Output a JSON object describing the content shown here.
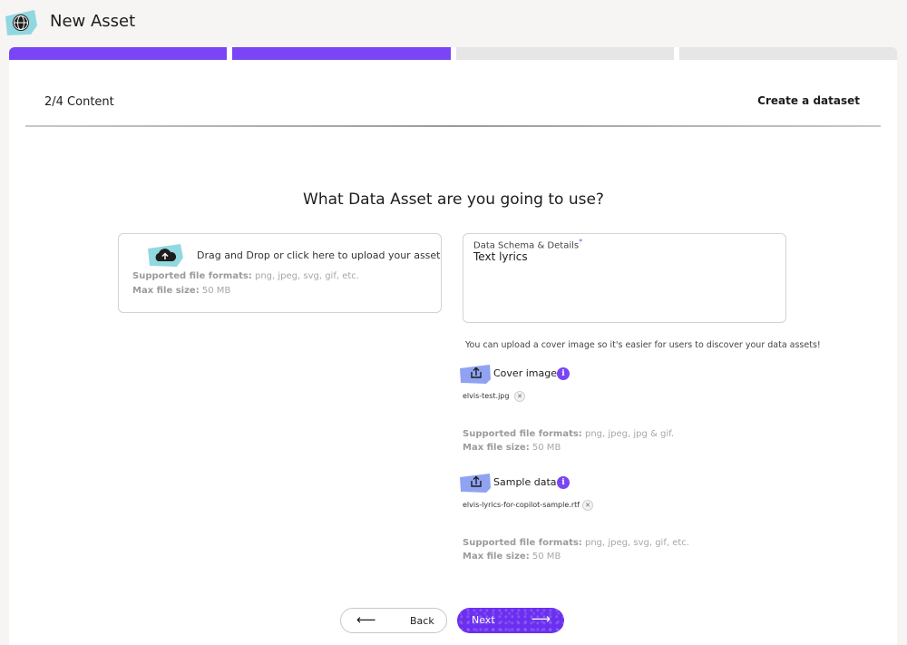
{
  "header": {
    "title": "New Asset",
    "logo_icon": "globe-logo-icon"
  },
  "progress": {
    "total_steps": 4,
    "completed_steps": 2,
    "active_color": "#7a45f5",
    "inactive_color": "#e6e6e6"
  },
  "step": {
    "label": "2/4 Content",
    "subtitle": "Create a dataset"
  },
  "main": {
    "question": "What Data Asset are you going to use?",
    "upload": {
      "text": "Drag and Drop or click here to upload your asset",
      "formats_label": "Supported file formats:",
      "formats_value": "png, jpeg, svg, gif, etc.",
      "size_label": "Max file size:",
      "size_value": "50 MB",
      "icon": "cloud-upload-icon"
    },
    "schema": {
      "label": "Data Schema & Details",
      "required_mark": "*",
      "value": "Text lyrics"
    },
    "cover_hint": "You can upload a cover image so it's easier for users to discover your data assets!",
    "cover": {
      "label": "Cover image",
      "file": "elvis-test.jpg",
      "formats_label": "Supported file formats:",
      "formats_value": "png, jpeg, jpg & gif.",
      "size_label": "Max file size:",
      "size_value": "50 MB"
    },
    "sample": {
      "label": "Sample data",
      "file": "elvis-lyrics-for-copilot-sample.rtf",
      "formats_label": "Supported file formats:",
      "formats_value": "png, jpeg, svg, gif, etc.",
      "size_label": "Max file size:",
      "size_value": "50 MB"
    }
  },
  "footer": {
    "back_label": "Back",
    "next_label": "Next",
    "next_color": "#6b2ff0"
  }
}
